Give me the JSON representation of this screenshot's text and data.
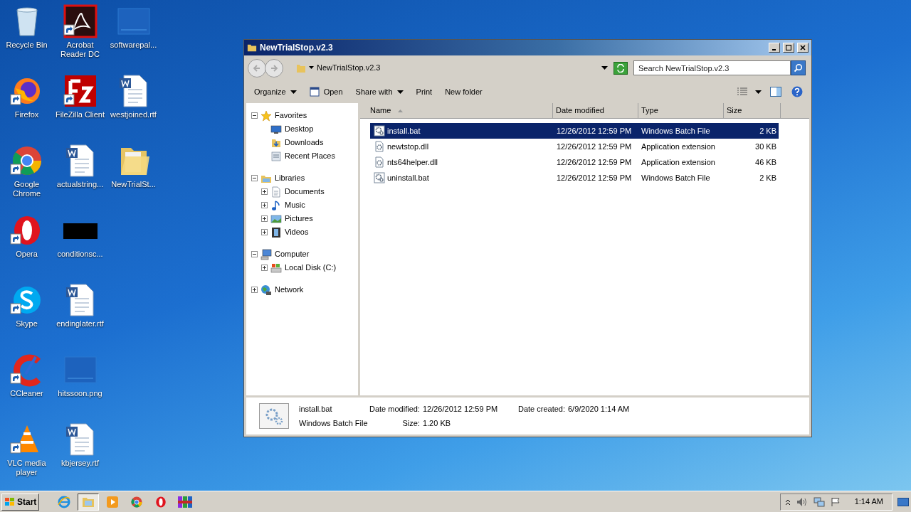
{
  "desktop_icons": [
    {
      "label": "Recycle Bin",
      "kind": "recycle",
      "shortcut": false
    },
    {
      "label": "Firefox",
      "kind": "firefox",
      "shortcut": true
    },
    {
      "label": "Google Chrome",
      "kind": "chrome",
      "shortcut": true
    },
    {
      "label": "Opera",
      "kind": "opera",
      "shortcut": true
    },
    {
      "label": "Skype",
      "kind": "skype",
      "shortcut": true
    },
    {
      "label": "CCleaner",
      "kind": "ccleaner",
      "shortcut": true
    },
    {
      "label": "VLC media player",
      "kind": "vlc",
      "shortcut": true
    },
    {
      "label": "Acrobat Reader DC",
      "kind": "acrobat",
      "shortcut": true
    },
    {
      "label": "FileZilla Client",
      "kind": "filezilla",
      "shortcut": true
    },
    {
      "label": "actualstring...",
      "kind": "document",
      "shortcut": false
    },
    {
      "label": "conditionsc...",
      "kind": "dark",
      "shortcut": false
    },
    {
      "label": "endinglater.rtf",
      "kind": "document",
      "shortcut": false
    },
    {
      "label": "hitssoon.png",
      "kind": "blank",
      "shortcut": false
    },
    {
      "label": "kbjersey.rtf",
      "kind": "document",
      "shortcut": false
    },
    {
      "label": "softwarepal...",
      "kind": "blank",
      "shortcut": false
    },
    {
      "label": "westjoined.rtf",
      "kind": "document",
      "shortcut": false
    },
    {
      "label": "NewTrialSt...",
      "kind": "folder",
      "shortcut": false
    }
  ],
  "window": {
    "title": "NewTrialStop.v2.3",
    "address": "NewTrialStop.v2.3",
    "search_placeholder": "Search NewTrialStop.v2.3",
    "toolbar": [
      {
        "label": "Organize",
        "kind": "menu"
      },
      {
        "label": "Open",
        "kind": "open"
      },
      {
        "label": "Share with",
        "kind": "menu"
      },
      {
        "label": "Print",
        "kind": "plain"
      },
      {
        "label": "New folder",
        "kind": "plain"
      }
    ],
    "nav": [
      {
        "label": "Favorites",
        "kind": "star",
        "expanded": true,
        "children": [
          {
            "label": "Desktop",
            "kind": "desktop"
          },
          {
            "label": "Downloads",
            "kind": "downloads"
          },
          {
            "label": "Recent Places",
            "kind": "recent"
          }
        ]
      },
      {
        "label": "Libraries",
        "kind": "library",
        "expanded": true,
        "children": [
          {
            "label": "Documents",
            "kind": "documents",
            "expanded": false
          },
          {
            "label": "Music",
            "kind": "music",
            "expanded": false
          },
          {
            "label": "Pictures",
            "kind": "pictures",
            "expanded": false
          },
          {
            "label": "Videos",
            "kind": "videos",
            "expanded": false
          }
        ]
      },
      {
        "label": "Computer",
        "kind": "computer",
        "expanded": true,
        "children": [
          {
            "label": "Local Disk (C:)",
            "kind": "disk",
            "expanded": false
          }
        ]
      },
      {
        "label": "Network",
        "kind": "network",
        "expanded": false
      }
    ],
    "columns": [
      "Name",
      "Date modified",
      "Type",
      "Size"
    ],
    "rows": [
      {
        "name": "install.bat",
        "kind": "batch",
        "date": "12/26/2012 12:59 PM",
        "type": "Windows Batch File",
        "size": "2 KB",
        "selected": true
      },
      {
        "name": "newtstop.dll",
        "kind": "dll",
        "date": "12/26/2012 12:59 PM",
        "type": "Application extension",
        "size": "30 KB",
        "selected": false
      },
      {
        "name": "nts64helper.dll",
        "kind": "dll",
        "date": "12/26/2012 12:59 PM",
        "type": "Application extension",
        "size": "46 KB",
        "selected": false
      },
      {
        "name": "uninstall.bat",
        "kind": "batch",
        "date": "12/26/2012 12:59 PM",
        "type": "Windows Batch File",
        "size": "2 KB",
        "selected": false
      }
    ],
    "details": {
      "name": "install.bat",
      "type": "Windows Batch File",
      "date_modified_label": "Date modified:",
      "date_modified": "12/26/2012 12:59 PM",
      "date_created_label": "Date created:",
      "date_created": "6/9/2020 1:14 AM",
      "size_label": "Size:",
      "size": "1.20 KB"
    }
  },
  "taskbar": {
    "start": "Start",
    "apps": [
      {
        "kind": "ie",
        "selected": false
      },
      {
        "kind": "explorer",
        "selected": true
      },
      {
        "kind": "media",
        "selected": false
      },
      {
        "kind": "chrome",
        "selected": false
      },
      {
        "kind": "opera",
        "selected": false
      },
      {
        "kind": "winrar",
        "selected": false
      }
    ],
    "time": "1:14 AM"
  }
}
